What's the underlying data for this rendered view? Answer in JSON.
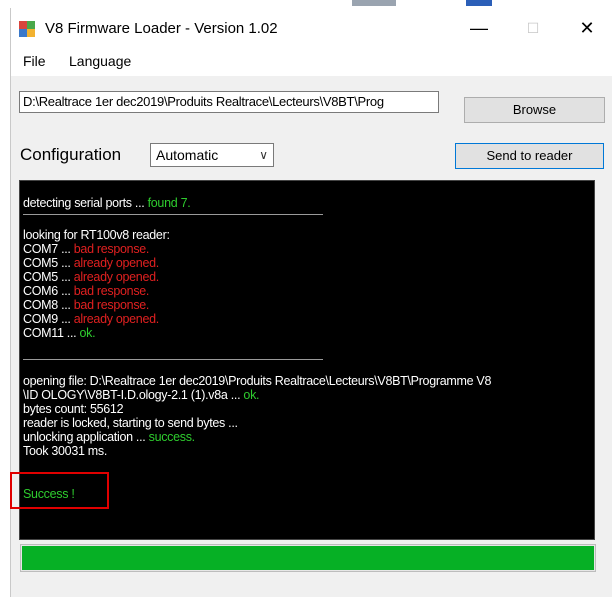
{
  "window": {
    "title": "V8 Firmware Loader - Version 1.02",
    "minimize_glyph": "—",
    "maximize_glyph": "☐",
    "close_glyph": "✕"
  },
  "menu": {
    "items": [
      "File",
      "Language"
    ]
  },
  "file_path": {
    "value": "D:\\Realtrace 1er dec2019\\Produits Realtrace\\Lecteurs\\V8BT\\Prog"
  },
  "buttons": {
    "browse": "Browse",
    "send": "Send to reader"
  },
  "configuration": {
    "label": "Configuration",
    "selected": "Automatic",
    "chevron": "∨"
  },
  "console": {
    "lines": [
      {
        "text": "detecting serial ports ... ",
        "status": "found 7.",
        "status_class": "ok"
      },
      {
        "text": "looking for RT100v8 reader:",
        "status": "",
        "status_class": ""
      },
      {
        "text": "COM7 ... ",
        "status": "bad response.",
        "status_class": "bad"
      },
      {
        "text": "COM5 ... ",
        "status": "already opened.",
        "status_class": "bad"
      },
      {
        "text": "COM5 ... ",
        "status": "already opened.",
        "status_class": "bad"
      },
      {
        "text": "COM6 ... ",
        "status": "bad response.",
        "status_class": "bad"
      },
      {
        "text": "COM8 ... ",
        "status": "bad response.",
        "status_class": "bad"
      },
      {
        "text": "COM9 ... ",
        "status": "already opened.",
        "status_class": "bad"
      },
      {
        "text": "COM11 ... ",
        "status": "ok.",
        "status_class": "ok"
      },
      {
        "text": "opening file: D:\\Realtrace 1er dec2019\\Produits Realtrace\\Lecteurs\\V8BT\\Programme V8",
        "status": "",
        "status_class": ""
      },
      {
        "text": "\\ID OLOGY\\V8BT-I.D.ology-2.1 (1).v8a ... ",
        "status": "ok.",
        "status_class": "ok"
      },
      {
        "text": "bytes count: 55612",
        "status": "",
        "status_class": ""
      },
      {
        "text": "reader is locked, starting to send bytes ...",
        "status": "",
        "status_class": ""
      },
      {
        "text": "unlocking application ... ",
        "status": "success.",
        "status_class": "ok"
      },
      {
        "text": "Took 30031 ms.",
        "status": "",
        "status_class": ""
      },
      {
        "text": "",
        "status": "Success !",
        "status_class": "ok"
      }
    ]
  },
  "progress": {
    "fraction": 1.0
  },
  "colors": {
    "ok": "#2ecc2e",
    "bad": "#e02020",
    "progress": "#06b025",
    "highlight_box": "#e00000"
  }
}
